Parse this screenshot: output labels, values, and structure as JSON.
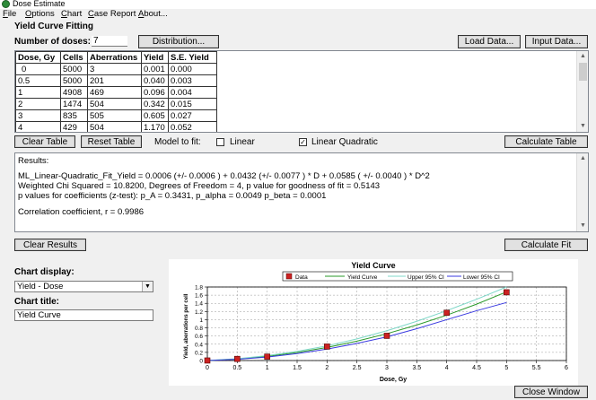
{
  "window": {
    "title": "Dose Estimate"
  },
  "menu": [
    {
      "u": "F",
      "rest": "ile"
    },
    {
      "u": "O",
      "rest": "ptions"
    },
    {
      "u": "C",
      "rest": "hart"
    },
    {
      "u": "C",
      "rest": "ase Report"
    },
    {
      "u": "A",
      "rest": "bout..."
    }
  ],
  "fitting": {
    "section_title": "Yield Curve Fitting",
    "num_doses_label": "Number of doses:",
    "num_doses_value": "7",
    "distribution_btn": "Distribution...",
    "load_data_btn": "Load Data...",
    "input_data_btn": "Input Data..."
  },
  "table": {
    "headers": [
      "Dose, Gy",
      "Cells",
      "Aberrations",
      "Yield",
      "S.E. Yield"
    ],
    "rows": [
      [
        "0",
        "5000",
        "3",
        "0.001",
        "0.000"
      ],
      [
        "0.5",
        "5000",
        "201",
        "0.040",
        "0.003"
      ],
      [
        "1",
        "4908",
        "469",
        "0.096",
        "0.004"
      ],
      [
        "2",
        "1474",
        "504",
        "0.342",
        "0.015"
      ],
      [
        "3",
        "835",
        "505",
        "0.605",
        "0.027"
      ],
      [
        "4",
        "429",
        "504",
        "1.170",
        "0.052"
      ]
    ]
  },
  "controls": {
    "clear_table": "Clear Table",
    "reset_table": "Reset Table",
    "model_label": "Model to fit:",
    "linear_label": "Linear",
    "linear_checked": false,
    "lq_label": "Linear Quadratic",
    "lq_checked": true,
    "calculate_table": "Calculate Table"
  },
  "results": {
    "label": "Results:",
    "lines": [
      "ML_Linear-Quadratic_Fit_Yield = 0.0006 (+/- 0.0006 ) + 0.0432 (+/- 0.0077 ) * D + 0.0585 ( +/- 0.0040 ) * D^2",
      "Weighted Chi Squared = 10.8200, Degrees of Freedom = 4, p value for goodness of fit = 0.5143",
      "p values for coefficients (z-test): p_A = 0.3431, p_alpha = 0.0049 p_beta = 0.0001",
      "Correlation coefficient, r = 0.9986"
    ],
    "clear_btn": "Clear Results",
    "calculate_fit_btn": "Calculate Fit"
  },
  "chart_settings": {
    "display_label": "Chart display:",
    "display_value": "Yield - Dose",
    "title_label": "Chart title:",
    "title_value": "Yield Curve"
  },
  "close_btn": "Close Window",
  "colors": {
    "data_marker": "#cc2222",
    "yield_curve": "#2a9a2a",
    "upper_ci": "#7fd8c8",
    "lower_ci": "#3a3ae0"
  },
  "chart_data": {
    "type": "line",
    "title": "Yield Curve",
    "xlabel": "Dose, Gy",
    "ylabel": "Yield, aberrations per cell",
    "xlim": [
      0,
      6
    ],
    "ylim": [
      0,
      1.8
    ],
    "xticks": [
      "0",
      "0.5",
      "1",
      "1.5",
      "2",
      "2.5",
      "3",
      "3.5",
      "4",
      "4.5",
      "5",
      "5.5",
      "6"
    ],
    "yticks": [
      "0",
      "0.2",
      "0.4",
      "0.6",
      "0.8",
      "1",
      "1.2",
      "1.4",
      "1.6",
      "1.8"
    ],
    "legend": [
      "Data",
      "Yield Curve",
      "Upper 95% CI",
      "Lower 95% CI"
    ],
    "legend_position": "top",
    "grid": true,
    "data_points": [
      {
        "x": 0,
        "y": 0.001
      },
      {
        "x": 0.5,
        "y": 0.04
      },
      {
        "x": 1,
        "y": 0.096
      },
      {
        "x": 2,
        "y": 0.342
      },
      {
        "x": 3,
        "y": 0.605
      },
      {
        "x": 4,
        "y": 1.17
      },
      {
        "x": 5,
        "y": 1.67
      }
    ],
    "series": [
      {
        "name": "Yield Curve",
        "x": [
          0,
          0.5,
          1,
          1.5,
          2,
          2.5,
          3,
          3.5,
          4,
          4.5,
          5
        ],
        "values": [
          0.001,
          0.037,
          0.102,
          0.197,
          0.321,
          0.474,
          0.657,
          0.869,
          1.11,
          1.38,
          1.68
        ]
      },
      {
        "name": "Upper 95% CI",
        "x": [
          0,
          0.5,
          1,
          1.5,
          2,
          2.5,
          3,
          3.5,
          4,
          4.5,
          5
        ],
        "values": [
          0.002,
          0.045,
          0.12,
          0.225,
          0.36,
          0.53,
          0.73,
          0.96,
          1.22,
          1.5,
          1.8
        ]
      },
      {
        "name": "Lower 95% CI",
        "x": [
          0,
          0.5,
          1,
          1.5,
          2,
          2.5,
          3,
          3.5,
          4,
          4.5,
          5
        ],
        "values": [
          0.0,
          0.03,
          0.085,
          0.17,
          0.28,
          0.42,
          0.58,
          0.78,
          1.0,
          1.22,
          1.42
        ]
      }
    ]
  }
}
